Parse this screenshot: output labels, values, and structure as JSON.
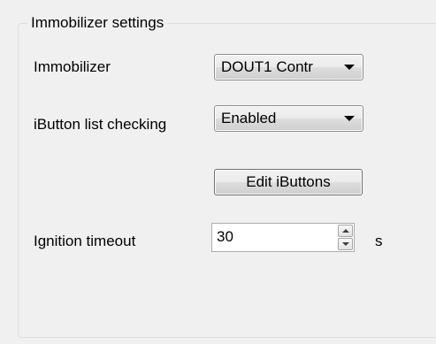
{
  "group": {
    "title": "Immobilizer settings"
  },
  "immobilizer": {
    "label": "Immobilizer",
    "selected": "DOUT1 Contr"
  },
  "ibutton_check": {
    "label": "iButton list checking",
    "selected": "Enabled"
  },
  "edit_ibuttons": {
    "label": "Edit iButtons"
  },
  "ignition_timeout": {
    "label": "Ignition timeout",
    "value": "30",
    "unit": "s"
  },
  "icons": {
    "combo_arrow": "chevron-down-icon",
    "spin_up": "spin-up-icon",
    "spin_down": "spin-down-icon"
  },
  "colors": {
    "background": "#f0f0f0",
    "group_border": "#d5dfe5",
    "input_border": "#abadb3"
  }
}
